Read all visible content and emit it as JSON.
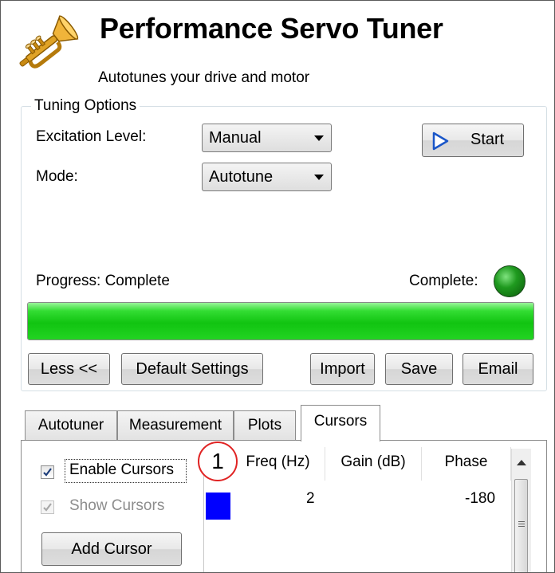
{
  "header": {
    "title": "Performance Servo Tuner",
    "subtitle": "Autotunes your drive and motor",
    "logo_icon": "trumpet-icon"
  },
  "tuning_options": {
    "group_label": "Tuning Options",
    "excitation_label": "Excitation Level:",
    "excitation_value": "Manual",
    "mode_label": "Mode:",
    "mode_value": "Autotune",
    "start_label": "Start",
    "progress_label": "Progress: Complete",
    "complete_label": "Complete:",
    "status_color": "#1f9a1f",
    "progress_fraction": 1.0,
    "progress_color": "#11c411"
  },
  "actions": {
    "less": "Less <<",
    "default_settings": "Default Settings",
    "import": "Import",
    "save": "Save",
    "email": "Email"
  },
  "tabs": [
    {
      "label": "Autotuner",
      "active": false
    },
    {
      "label": "Measurement",
      "active": false
    },
    {
      "label": "Plots",
      "active": false
    },
    {
      "label": "Cursors",
      "active": true
    }
  ],
  "cursors": {
    "enable_label": "Enable Cursors",
    "enable_checked": true,
    "show_label": "Show Cursors",
    "show_checked": true,
    "show_enabled": false,
    "add_label": "Add Cursor"
  },
  "grid": {
    "columns": [
      "Freq (Hz)",
      "Gain (dB)",
      "Phase"
    ],
    "rows": [
      {
        "color": "#0000ff",
        "freq": "2",
        "gain": "",
        "phase": "-180"
      }
    ]
  },
  "callout": "1"
}
